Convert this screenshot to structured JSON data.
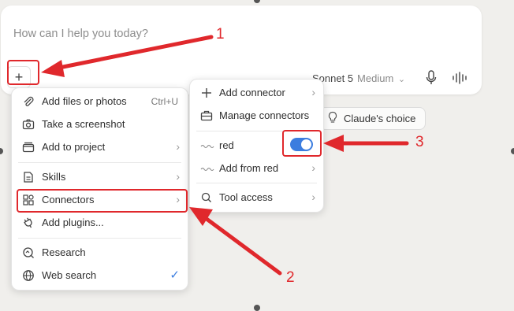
{
  "composer": {
    "placeholder": "How can I help you today?",
    "plus_label": "+",
    "model_name": "Sonnet 5",
    "model_effort": "Medium",
    "chevron": "⌄"
  },
  "suggestion": {
    "label": "Claude's choice"
  },
  "menu_main": {
    "items": [
      {
        "label": "Add files or photos",
        "shortcut": "Ctrl+U",
        "icon": "paperclip-icon"
      },
      {
        "label": "Take a screenshot",
        "icon": "camera-icon"
      },
      {
        "label": "Add to project",
        "chevron": "›",
        "icon": "folder-icon"
      },
      {
        "label": "Skills",
        "chevron": "›",
        "icon": "skills-icon"
      },
      {
        "label": "Connectors",
        "chevron": "›",
        "icon": "connectors-icon"
      },
      {
        "label": "Add plugins...",
        "icon": "plug-icon"
      },
      {
        "label": "Research",
        "icon": "research-icon"
      },
      {
        "label": "Web search",
        "check": "✓",
        "icon": "globe-icon"
      }
    ]
  },
  "menu_connectors": {
    "items": [
      {
        "label": "Add connector",
        "chevron": "›",
        "icon": "plus-icon"
      },
      {
        "label": "Manage connectors",
        "icon": "briefcase-icon"
      },
      {
        "label": "red",
        "toggle_on": true,
        "icon": "red-logo-icon"
      },
      {
        "label": "Add from red",
        "chevron": "›",
        "icon": "red-logo-icon"
      },
      {
        "label": "Tool access",
        "chevron": "›",
        "icon": "search-icon"
      }
    ]
  },
  "annotations": {
    "n1": "1",
    "n2": "2",
    "n3": "3",
    "color": "#e0282c"
  }
}
